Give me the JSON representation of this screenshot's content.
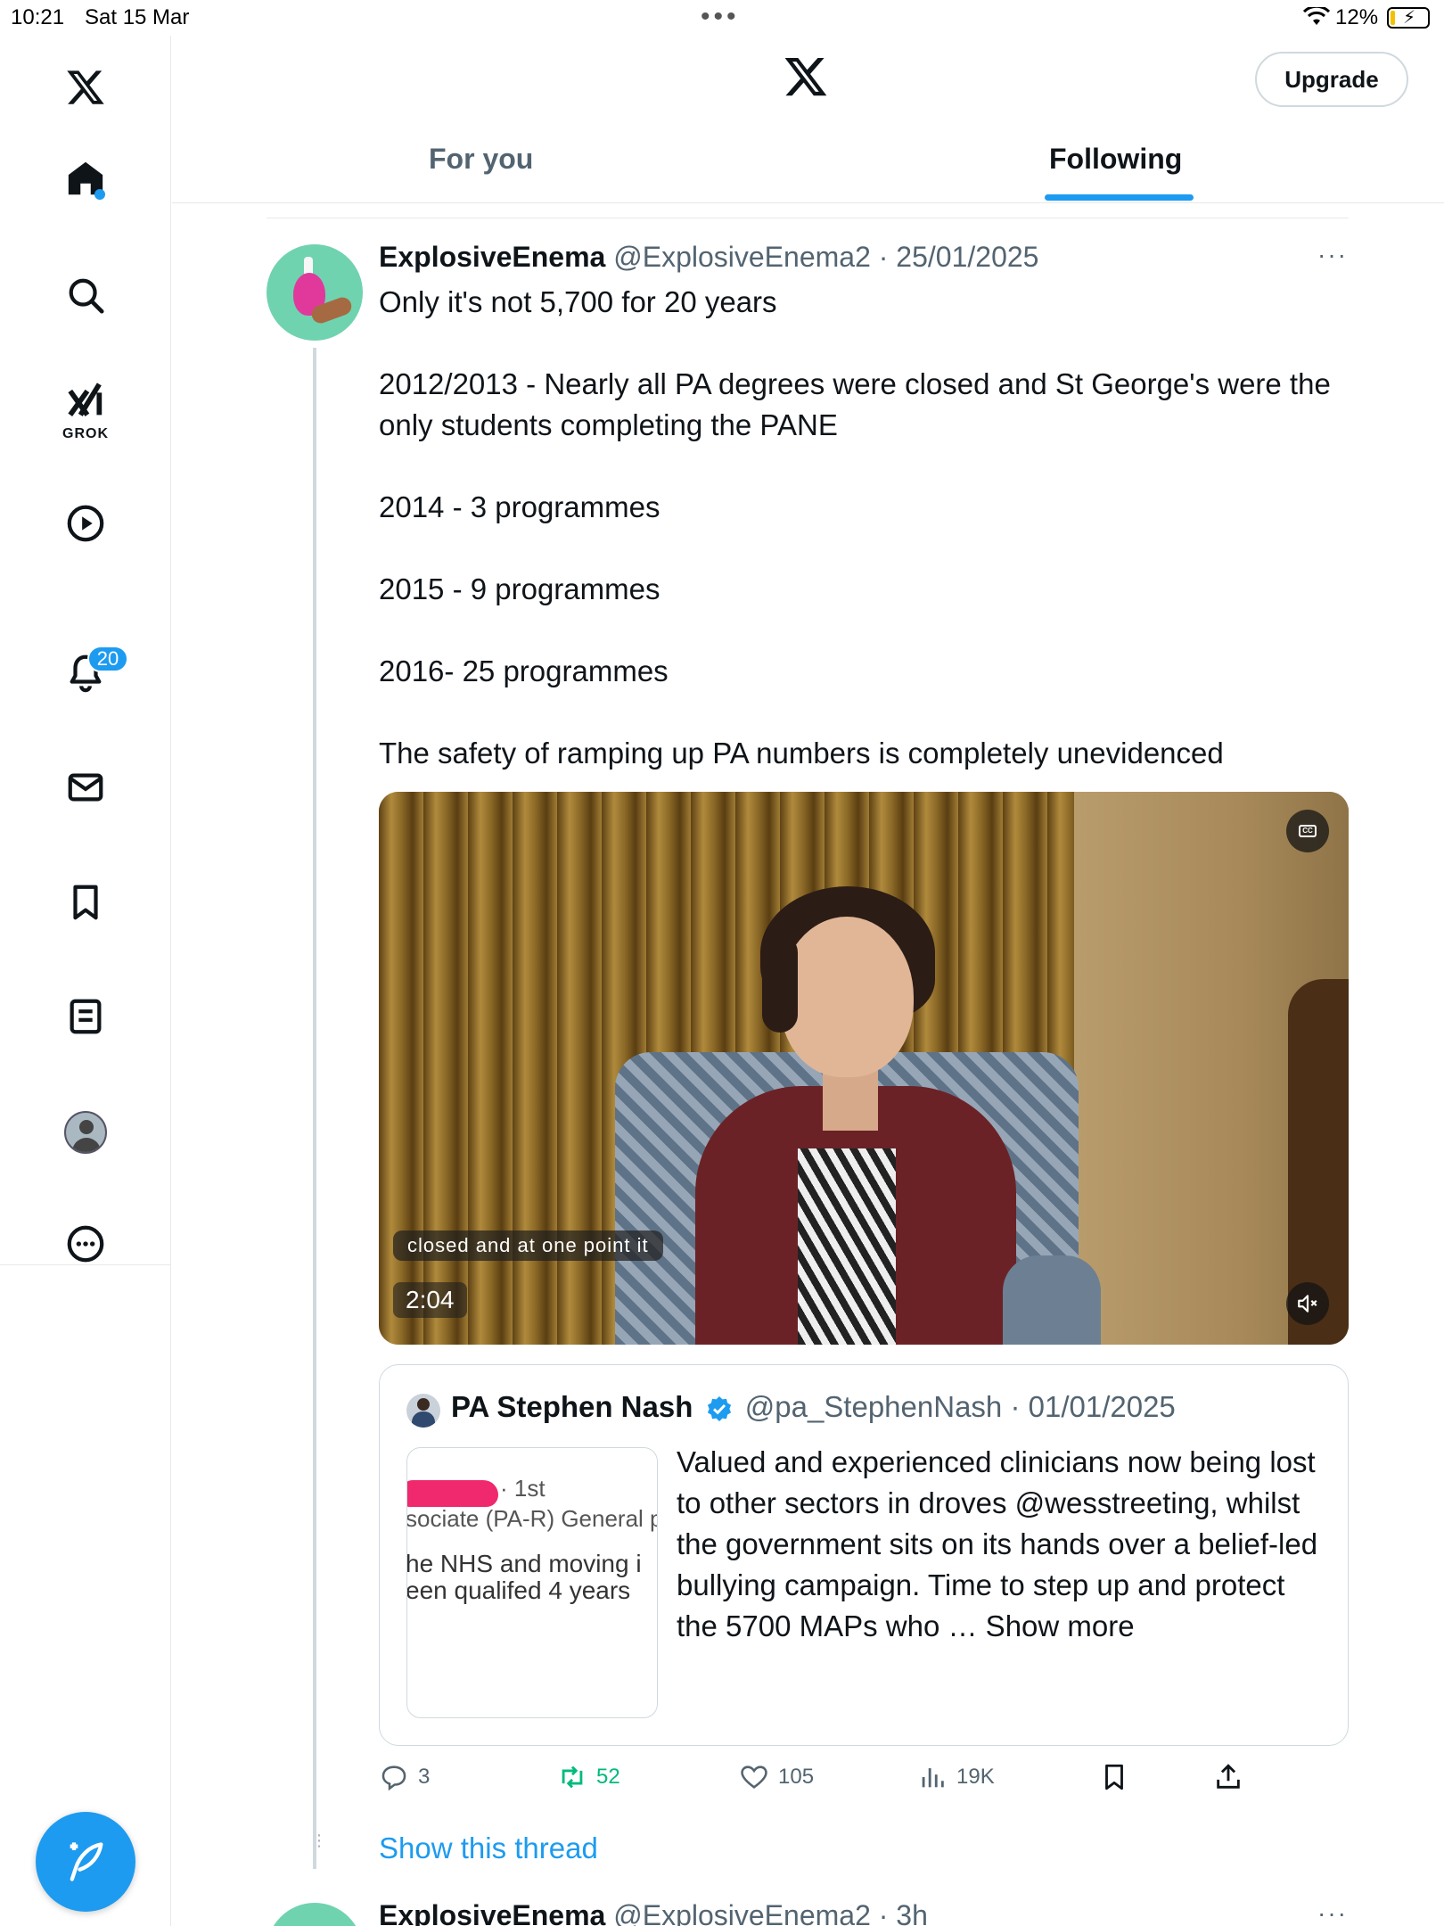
{
  "status_bar": {
    "time": "10:21",
    "date": "Sat 15 Mar",
    "battery": "12%",
    "battery_level": 0.12
  },
  "sidebar": {
    "grok_label": "GROK",
    "notifications_badge": "20",
    "icons": [
      "x-logo-icon",
      "home-icon",
      "search-icon",
      "grok-icon",
      "video-icon",
      "bell-icon",
      "mail-icon",
      "bookmark-icon",
      "lists-icon",
      "profile-icon",
      "more-icon",
      "compose-icon"
    ]
  },
  "header": {
    "upgrade_label": "Upgrade",
    "tabs": [
      {
        "label": "For you",
        "active": false
      },
      {
        "label": "Following",
        "active": true
      }
    ]
  },
  "tweet": {
    "name": "ExplosiveEnema",
    "handle": "@ExplosiveEnema2",
    "separator": "·",
    "date": "25/01/2025",
    "more": "···",
    "lines": [
      "Only it's not 5,700 for 20 years",
      "",
      "2012/2013 - Nearly all PA degrees were closed and St George's were the only students completing the PANE",
      "",
      "2014 - 3 programmes",
      "",
      "2015 - 9 programmes",
      "",
      "2016- 25 programmes",
      "",
      "The safety of ramping up PA numbers is completely unevidenced"
    ],
    "video": {
      "caption": "closed and at one point it",
      "duration": "2:04"
    },
    "quote": {
      "name": "PA Stephen Nash",
      "handle": "@pa_StephenNash",
      "separator": "·",
      "date": "01/01/2025",
      "thumb_lines": [
        "· 1st",
        "sociate (PA-R) General p",
        "he NHS and moving i",
        "een qualifed 4 years"
      ],
      "text": "Valued and experienced clinicians now being lost to other sectors in droves @wesstreeting, whilst the government sits on its hands over a belief-led bullying campaign. Time to step up and protect the 5700 MAPs who … Show more"
    },
    "actions": {
      "replies": "3",
      "retweets": "52",
      "likes": "105",
      "views": "19K"
    },
    "show_thread": "Show this thread"
  },
  "next_tweet": {
    "name": "ExplosiveEnema",
    "handle": "@ExplosiveEnema2",
    "separator": "·",
    "time": "3h",
    "more": "···"
  },
  "colors": {
    "accent": "#1d9bf0",
    "retweet_green": "#00ba7c",
    "muted_text": "#536471"
  }
}
